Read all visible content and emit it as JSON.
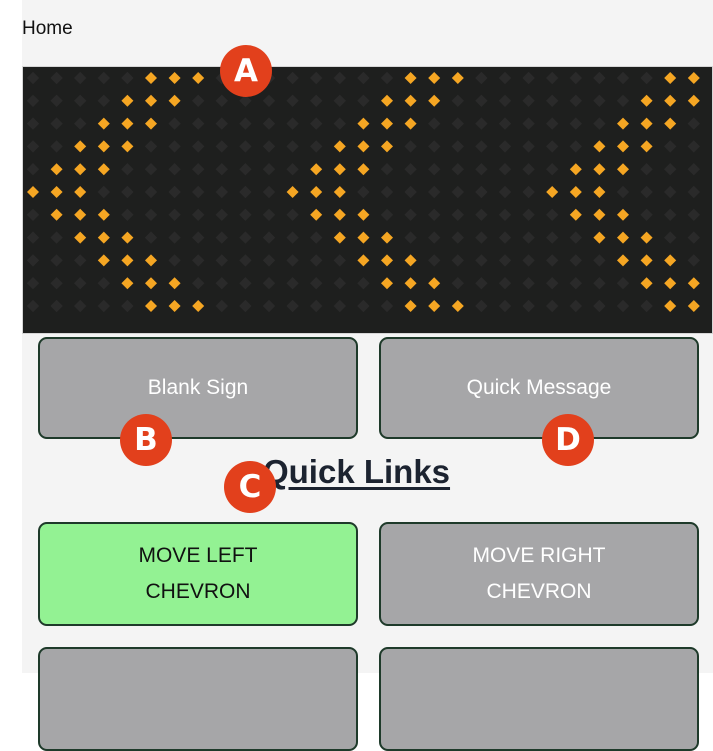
{
  "header": {
    "title": "Home"
  },
  "sign": {
    "grid_cols": 29,
    "grid_rows": 11,
    "dot_off_color": "#2a2a2a",
    "dot_on_color": "#f5a623",
    "background_color": "#1e1f1e",
    "chevron_start_cols": [
      0,
      11,
      22
    ],
    "chevron_offsets": [
      5,
      4,
      3,
      2,
      1,
      0,
      1,
      2,
      3,
      4,
      5
    ]
  },
  "actions": {
    "blank_sign_label": "Blank Sign",
    "quick_message_label": "Quick Message"
  },
  "quick_links": {
    "title": "Quick Links",
    "items": [
      {
        "label": "MOVE LEFT CHEVRON",
        "active": true
      },
      {
        "label": "MOVE RIGHT CHEVRON",
        "active": false
      },
      {
        "label": "",
        "active": false
      },
      {
        "label": "",
        "active": false
      }
    ]
  },
  "markers": {
    "a": "A",
    "b": "B",
    "c": "C",
    "d": "D"
  },
  "colors": {
    "button_gray": "#a6a6a8",
    "button_active_green": "#93f293",
    "button_border": "#1e3a2a",
    "marker_red": "#e2401c"
  }
}
